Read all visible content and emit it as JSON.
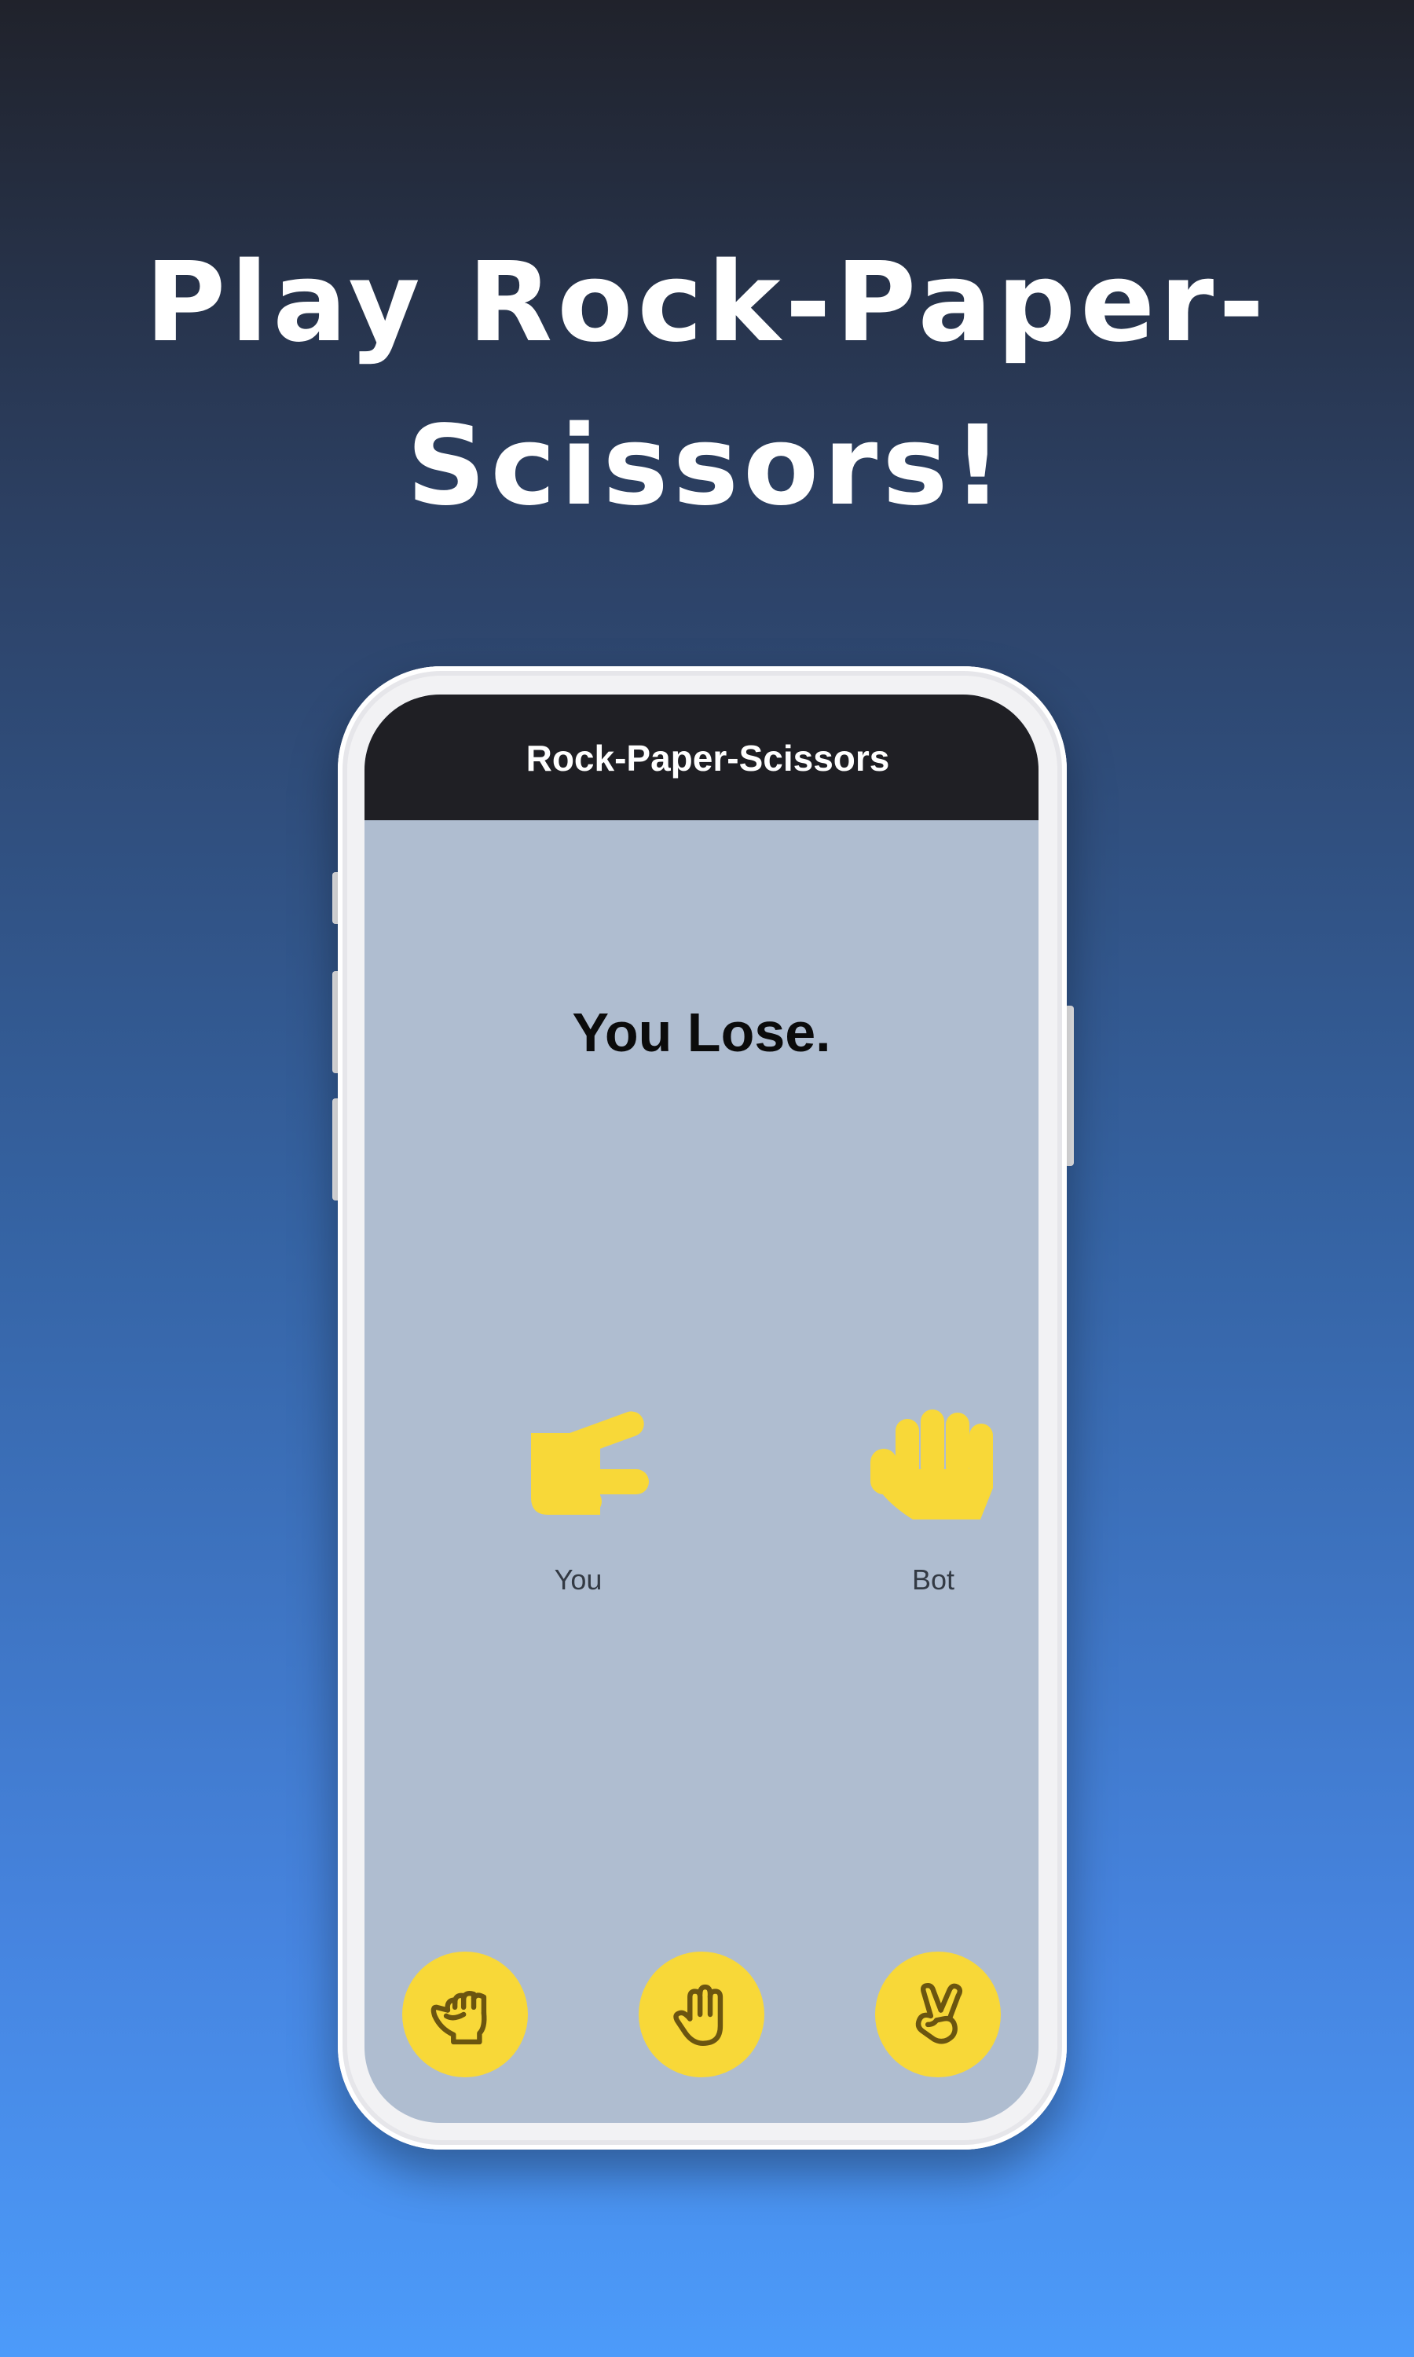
{
  "promo": {
    "headline_line1": "Play Rock-Paper-",
    "headline_line2": "Scissors!"
  },
  "app": {
    "title": "Rock-Paper-Scissors",
    "result": "You Lose.",
    "players": {
      "you": {
        "label": "You",
        "move_icon": "scissors-hand-icon"
      },
      "bot": {
        "label": "Bot",
        "move_icon": "paper-hand-icon"
      }
    },
    "choices": [
      {
        "name": "rock",
        "icon": "rock-fist-icon"
      },
      {
        "name": "paper",
        "icon": "paper-hand-icon"
      },
      {
        "name": "scissors",
        "icon": "scissors-hand-icon"
      }
    ]
  },
  "colors": {
    "accent_yellow": "#f8d838",
    "icon_brown": "#6b5510",
    "screen_bg": "#afbdd0",
    "appbar_bg": "#1f1f24"
  }
}
